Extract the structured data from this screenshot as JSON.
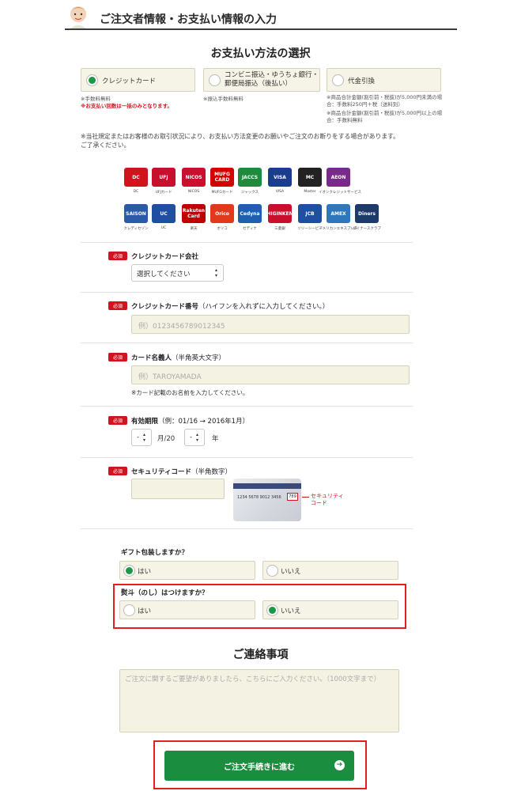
{
  "header": {
    "title": "ご注文者情報・お支払い情報の入力"
  },
  "payment": {
    "title": "お支払い方法の選択",
    "options": [
      {
        "label": "クレジットカード",
        "notes": [
          "※手数料無料"
        ],
        "red_note": "※お支払い回数は一括のみとなります。",
        "selected": true
      },
      {
        "label_line1": "コンビニ振込・ゆうちょ銀行・",
        "label_line2": "郵便局振込（後払い）",
        "notes": [
          "※振込手数料無料"
        ],
        "selected": false
      },
      {
        "label": "代金引換",
        "notes": [
          "※商品合計金額(割引前・税抜)が5,000円未満の場",
          "合：手数料250円＋税（送料別）",
          "※商品合計金額(割引前・税抜)が5,000円以上の場",
          "合：手数料無料"
        ],
        "selected": false
      }
    ],
    "notice_line1": "※当社規定またはお客様のお取引状況により、お支払い方法変更のお願いやご注文のお断りをする場合があります。",
    "notice_line2": "ご了承ください。"
  },
  "card_brands": [
    {
      "logo": "DC",
      "caption": "DC",
      "color": "#d0141d"
    },
    {
      "logo": "UFJ",
      "caption": "UFJカード",
      "color": "#c8102e"
    },
    {
      "logo": "NICOS",
      "caption": "NICOS",
      "color": "#c8102e"
    },
    {
      "logo": "MUFG CARD",
      "caption": "MUFGカード",
      "color": "#d40000"
    },
    {
      "logo": "JACCS",
      "caption": "ジャックス",
      "color": "#1f8a3b"
    },
    {
      "logo": "VISA",
      "caption": "VISA",
      "color": "#1a3d8f"
    },
    {
      "logo": "MC",
      "caption": "Master",
      "color": "#222222"
    },
    {
      "logo": "AEON",
      "caption": "イオンクレジットサービス",
      "color": "#7a2a8a"
    },
    {
      "logo": "SAISON",
      "caption": "クレディセゾン",
      "color": "#2a5aa8"
    },
    {
      "logo": "UC",
      "caption": "UC",
      "color": "#1f4fa0"
    },
    {
      "logo": "Rakuten Card",
      "caption": "楽天",
      "color": "#bf0000"
    },
    {
      "logo": "Orico",
      "caption": "オリコ",
      "color": "#e03a1a"
    },
    {
      "logo": "Cedyna",
      "caption": "セディナ",
      "color": "#1f5fb0"
    },
    {
      "logo": "HIGINKEN",
      "caption": "三菱銀",
      "color": "#c8102e"
    },
    {
      "logo": "JCB",
      "caption": "ソリーシービー",
      "color": "#1f4fa0"
    },
    {
      "logo": "AMEX",
      "caption": "アメリカンエキスプレス",
      "color": "#2e77bc"
    },
    {
      "logo": "Diners",
      "caption": "ダイナースクラブ",
      "color": "#1e3a6a"
    }
  ],
  "form": {
    "required_badge": "必須",
    "company_label": "クレジットカード会社",
    "company_value": "選択してください",
    "number_label": "クレジットカード番号",
    "number_sub": "（ハイフンを入れずに入力してください。）",
    "number_placeholder": "例）0123456789012345",
    "holder_label": "カード名義人",
    "holder_sub": "（半角英大文字）",
    "holder_placeholder": "例）TAROYAMADA",
    "holder_note": "※カード記載のお名前を入力してください。",
    "expiry_label": "有効期限",
    "expiry_sub": "（例：01/16 → 2016年1月）",
    "expiry_month": "-",
    "expiry_month_suffix": "月/20",
    "expiry_year": "-",
    "expiry_year_suffix": "年",
    "security_label": "セキュリティコード",
    "security_sub": "（半角数字）",
    "card_number_sample": "1234  5678  9012  3456",
    "card_cvv_sample": "789",
    "security_pointer_line1": "セキュリティ",
    "security_pointer_line2": "コード"
  },
  "gift": {
    "question": "ギフト包装しますか？",
    "yes": "はい",
    "no": "いいえ",
    "selected": "yes"
  },
  "noshi": {
    "question": "熨斗（のし）はつけますか？",
    "yes": "はい",
    "no": "いいえ",
    "selected": "no"
  },
  "contact": {
    "title": "ご連絡事項",
    "placeholder": "ご注文に関するご要望がありましたら、こちらにご入力ください。（1000文字まで）"
  },
  "submit": {
    "label": "ご注文手続きに進む",
    "arrow": "➔"
  },
  "colors": {
    "accent_green": "#1a8d3f",
    "required_red": "#d0141d",
    "highlight_frame": "#e02020"
  }
}
